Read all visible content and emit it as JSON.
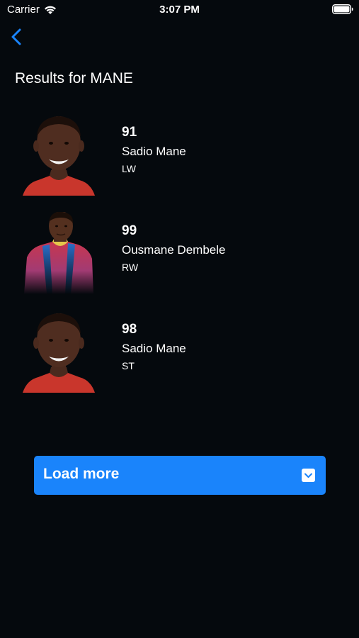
{
  "status_bar": {
    "carrier": "Carrier",
    "time": "3:07 PM"
  },
  "nav": {
    "back_icon": "chevron-left-icon"
  },
  "header": {
    "title": "Results for MANE"
  },
  "results": [
    {
      "rating": "91",
      "name": "Sadio Mane",
      "position": "LW"
    },
    {
      "rating": "99",
      "name": "Ousmane Dembele",
      "position": "RW"
    },
    {
      "rating": "98",
      "name": "Sadio Mane",
      "position": "ST"
    }
  ],
  "load_more": {
    "label": "Load more",
    "icon": "chevron-down-box-icon"
  },
  "colors": {
    "background": "#05090d",
    "accent": "#1a84fb"
  }
}
